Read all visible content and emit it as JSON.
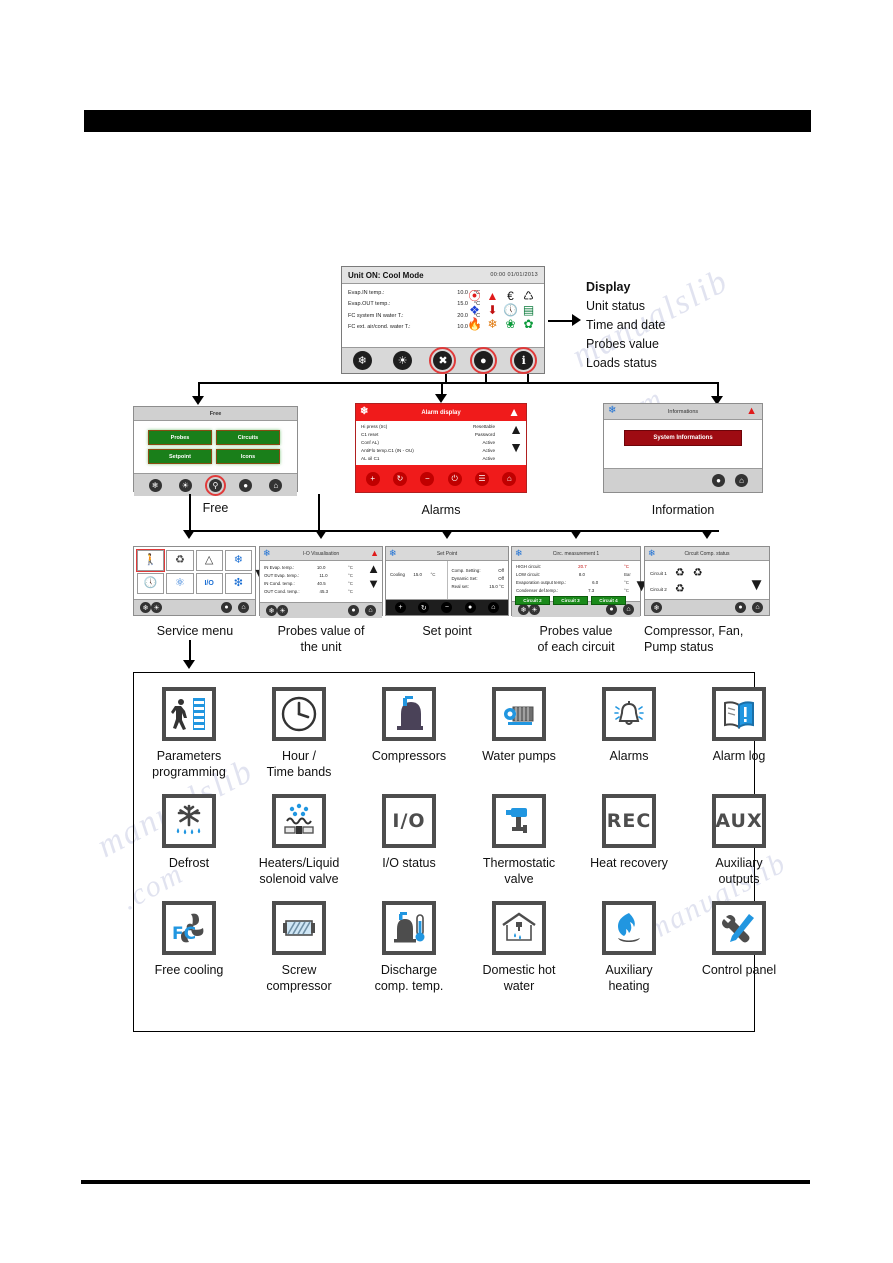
{
  "main_display": {
    "title": "Unit ON: Cool Mode",
    "datetime": "00:00  01/01/2013",
    "rows": [
      {
        "label": "Evap.IN temp.:",
        "value": "10.0",
        "unit": "°C"
      },
      {
        "label": "Evap.OUT temp.:",
        "value": "15.0",
        "unit": "°C"
      },
      {
        "label": "FC system IN water T.:",
        "value": "20.0",
        "unit": "°C"
      },
      {
        "label": "FC ext. air/cond. water T.:",
        "value": "10.0",
        "unit": "°C"
      }
    ],
    "status_icons": [
      [
        "defrost-icon",
        "warning-icon",
        "energy-saving-icon",
        "compressor-icon"
      ],
      [
        "antifreeze-icon",
        "pumpdown-icon",
        "clock-icon",
        "valve-icon"
      ],
      [
        "flame-icon",
        "heater-icon",
        "fan-icon",
        "freecooling-fan-icon"
      ]
    ],
    "footer_buttons": [
      "cool-mode-button",
      "heat-mode-button",
      "service-menu-button",
      "alarms-button",
      "information-button"
    ]
  },
  "display_callout": {
    "heading": "Display",
    "lines": [
      "Unit status",
      "Time and date",
      "Probes value",
      "Loads status"
    ]
  },
  "free_panel": {
    "title": "Free",
    "buttons": [
      "Probes",
      "Circuits",
      "Setpoint",
      "Icons"
    ],
    "caption": "Free",
    "footer_buttons": [
      "cool-icon",
      "heat-icon",
      "wrench-icon",
      "bell-icon",
      "home-icon"
    ]
  },
  "alarm_panel": {
    "title": "Alarm display",
    "rows": [
      {
        "name": "Hi press (trc)",
        "state": "Resettable"
      },
      {
        "name": "C1 reset",
        "state": "Password"
      },
      {
        "name": "Conf AL)",
        "state": "Active"
      },
      {
        "name": "AntiFlo temp.C1 (IN - OU)",
        "state": "Active"
      },
      {
        "name": "AL oil C1",
        "state": "Active"
      }
    ],
    "caption": "Alarms",
    "footer_buttons": [
      "plus-button",
      "reset-button",
      "minus-button",
      "power-button",
      "log-button",
      "home-button"
    ]
  },
  "info_panel": {
    "title": "Informations",
    "button": "System Informations",
    "caption": "Information",
    "footer_buttons": [
      "bell-icon",
      "home-icon"
    ]
  },
  "service_panel": {
    "caption": "Service menu",
    "cells": [
      "parameters-icon",
      "compressor-icon",
      "alarms-icon",
      "defrost-icon",
      "clock-icon",
      "pump-icon",
      "io-icon",
      "freecooling-icon"
    ]
  },
  "probe_unit_panel": {
    "title": "I-O Visualisation",
    "rows": [
      {
        "label": "IN Evap. temp.:",
        "value": "10.0",
        "unit": "°C"
      },
      {
        "label": "OUT Evap. temp.:",
        "value": "11.0",
        "unit": "°C"
      },
      {
        "label": "IN Cond. temp.:",
        "value": "40.5",
        "unit": "°C"
      },
      {
        "label": "OUT Cond. temp.:",
        "value": "45.3",
        "unit": "°C"
      }
    ],
    "caption": "Probes value of\nthe unit",
    "caption_line1": "Probes value of",
    "caption_line2": "the unit"
  },
  "setpoint_panel": {
    "title": "Set Point",
    "left_rows": [
      {
        "label": "Cooling",
        "value": "15.0",
        "unit": "°C"
      }
    ],
    "right_rows": [
      {
        "label": "Comp. Setting:",
        "value": "Off"
      },
      {
        "label": "Dynamic Set:",
        "value": "Off"
      },
      {
        "label": "Real set:",
        "value": "15.0 °C"
      }
    ],
    "caption": "Set point"
  },
  "probe_circuit_panel": {
    "title": "Circ. measurement 1",
    "rows": [
      {
        "label": "HIGH circuit:",
        "value": "20.7",
        "unit": "°C"
      },
      {
        "label": "LOW circuit:",
        "value": "8.0",
        "unit": "Bar"
      },
      {
        "label": "Evaporation output temp.:",
        "value": "6.0",
        "unit": "°C"
      },
      {
        "label": "Condenser def.temp.:",
        "value": "7.3",
        "unit": "°C"
      }
    ],
    "badges": [
      "Circuit 2",
      "Circuit 3",
      "Circuit 4"
    ],
    "caption_line1": "Probes value",
    "caption_line2": "of each circuit"
  },
  "compressor_panel": {
    "title": "Circuit Comp. status",
    "rows": [
      {
        "label": "Circuit 1",
        "icons": [
          "comp-1-icon",
          "comp-2-icon"
        ]
      },
      {
        "label": "Circuit 2",
        "icons": [
          "comp-3-icon"
        ]
      }
    ],
    "caption_line1": "Compressor, Fan,",
    "caption_line2": "Pump status"
  },
  "icon_grid": {
    "rows": [
      [
        {
          "icon": "parameters-programming-icon",
          "label": "Parameters\nprogramming",
          "l1": "Parameters",
          "l2": "programming"
        },
        {
          "icon": "clock-icon",
          "label": "Hour /\nTime bands",
          "l1": "Hour /",
          "l2": "Time bands"
        },
        {
          "icon": "compressor-icon",
          "label": "Compressors",
          "l1": "Compressors",
          "l2": ""
        },
        {
          "icon": "water-pump-icon",
          "label": "Water pumps",
          "l1": "Water pumps",
          "l2": ""
        },
        {
          "icon": "alarm-bell-icon",
          "label": "Alarms",
          "l1": "Alarms",
          "l2": ""
        },
        {
          "icon": "alarm-log-icon",
          "label": "Alarm log",
          "l1": "Alarm log",
          "l2": ""
        }
      ],
      [
        {
          "icon": "defrost-icon",
          "label": "Defrost",
          "l1": "Defrost",
          "l2": ""
        },
        {
          "icon": "heaters-solenoid-icon",
          "label": "Heaters/Liquid\nsolenoid valve",
          "l1": "Heaters/Liquid",
          "l2": "solenoid valve"
        },
        {
          "icon": "io-status-icon",
          "label": "I/O status",
          "l1": "I/O status",
          "l2": ""
        },
        {
          "icon": "thermostatic-valve-icon",
          "label": "Thermostatic\nvalve",
          "l1": "Thermostatic",
          "l2": "valve"
        },
        {
          "icon": "heat-recovery-icon",
          "label": "Heat recovery",
          "l1": "Heat recovery",
          "l2": ""
        },
        {
          "icon": "auxiliary-outputs-icon",
          "label": "Auxiliary\noutputs",
          "l1": "Auxiliary",
          "l2": "outputs"
        }
      ],
      [
        {
          "icon": "free-cooling-icon",
          "label": "Free cooling",
          "l1": "Free cooling",
          "l2": ""
        },
        {
          "icon": "screw-compressor-icon",
          "label": "Screw\ncompressor",
          "l1": "Screw",
          "l2": "compressor"
        },
        {
          "icon": "discharge-temp-icon",
          "label": "Discharge\ncomp. temp.",
          "l1": "Discharge",
          "l2": "comp. temp."
        },
        {
          "icon": "domestic-hot-water-icon",
          "label": "Domestic hot\nwater",
          "l1": "Domestic hot",
          "l2": "water"
        },
        {
          "icon": "auxiliary-heating-icon",
          "label": "Auxiliary\nheating",
          "l1": "Auxiliary",
          "l2": "heating"
        },
        {
          "icon": "control-panel-icon",
          "label": "Control panel",
          "l1": "Control panel",
          "l2": ""
        }
      ]
    ]
  },
  "icon_text_labels": {
    "io": "I/O",
    "rec": "REC",
    "aux": "AUX",
    "fc": "FC"
  },
  "watermark": {
    "l1": "manualslib",
    "l2": ".com",
    "l3": "manualslib",
    "l4": ".com",
    "l5": "manualslib"
  },
  "colors": {
    "alarm_red": "#f01b1b",
    "brand_blue": "#2196e0",
    "green": "#1a8a1a",
    "dark_red": "#9e0b12"
  }
}
